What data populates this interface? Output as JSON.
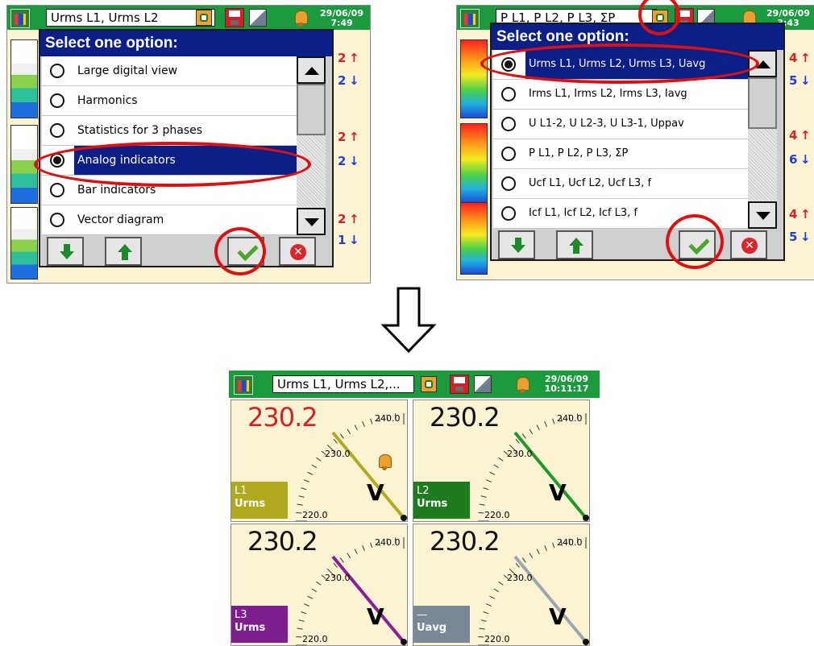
{
  "left_screen": {
    "title": "Urms L1, Urms L2",
    "datetime_line1": "29/06/09",
    "datetime_line2": "7:49",
    "dialog_title": "Select one option:",
    "options": [
      {
        "label": "Large digital view",
        "selected": false
      },
      {
        "label": "Harmonics",
        "selected": false
      },
      {
        "label": "Statistics for 3 phases",
        "selected": false
      },
      {
        "label": "Analog indicators",
        "selected": true
      },
      {
        "label": "Bar indicators",
        "selected": false
      },
      {
        "label": "Vector diagram",
        "selected": false
      }
    ],
    "side_values": [
      {
        "up": "2",
        "down": "2"
      },
      {
        "up": "2",
        "down": "2"
      },
      {
        "up": "2",
        "down": "1"
      }
    ]
  },
  "right_screen": {
    "title": "P L1, P L2, P L3, ΣP",
    "datetime_line1": "29/06/09",
    "datetime_line2": "3:43",
    "dialog_title": "Select one option:",
    "options": [
      {
        "label": "Urms L1, Urms L2, Urms L3, Uavg",
        "selected": true
      },
      {
        "label": "Irms L1, Irms L2, Irms L3, Iavg",
        "selected": false
      },
      {
        "label": "U L1-2, U L2-3, U L3-1, Uppav",
        "selected": false
      },
      {
        "label": "P L1, P L2, P L3, ΣP",
        "selected": false
      },
      {
        "label": "Ucf L1, Ucf L2, Ucf L3, f",
        "selected": false
      },
      {
        "label": "Icf L1, Icf L2, Icf L3, f",
        "selected": false
      }
    ],
    "side_values": [
      {
        "up": "4",
        "down": "5"
      },
      {
        "up": "4",
        "down": "6"
      },
      {
        "up": "4",
        "down": "5"
      }
    ]
  },
  "result_screen": {
    "title": "Urms L1, Urms L2,...",
    "datetime_line1": "29/06/09",
    "datetime_line2": "10:11:17",
    "meters": [
      {
        "value": "230.2",
        "value_color": "#d81f26",
        "phase": "L1",
        "quantity": "Urms",
        "tag_color": "#b0ab1e",
        "needle_color": "#b0ab1e",
        "unit": "V",
        "scale_max": "240.0",
        "scale_mid": "230.0",
        "scale_min": "220.0",
        "alarm": true
      },
      {
        "value": "230.2",
        "value_color": "#111111",
        "phase": "L2",
        "quantity": "Urms",
        "tag_color": "#1e7b1e",
        "needle_color": "#1e9a2a",
        "unit": "V",
        "scale_max": "240.0",
        "scale_mid": "230.0",
        "scale_min": "220.0",
        "alarm": false
      },
      {
        "value": "230.2",
        "value_color": "#111111",
        "phase": "L3",
        "quantity": "Urms",
        "tag_color": "#7e1e8e",
        "needle_color": "#8a1e9a",
        "unit": "V",
        "scale_max": "240.0",
        "scale_mid": "230.0",
        "scale_min": "220.0",
        "alarm": false
      },
      {
        "value": "230.2",
        "value_color": "#111111",
        "phase": "—",
        "quantity": "Uavg",
        "tag_color": "#7a8794",
        "needle_color": "#9aa6b0",
        "unit": "V",
        "scale_max": "240.0",
        "scale_mid": "230.0",
        "scale_min": "220.0",
        "alarm": false
      }
    ]
  },
  "colors": {
    "topbar": "#1c9a3e",
    "dialog_title": "#0b1f87",
    "annotation": "#e01010",
    "alarm_up": "#d81f26",
    "down": "#1f3fd8"
  }
}
